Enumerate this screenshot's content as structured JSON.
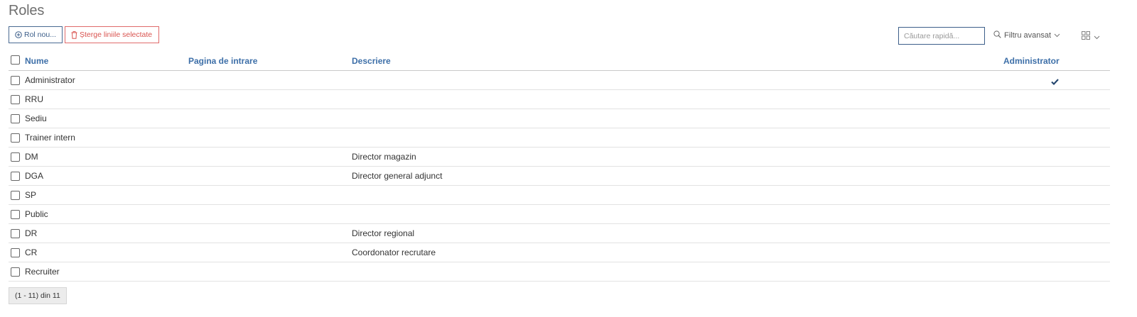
{
  "page": {
    "title": "Roles"
  },
  "toolbar": {
    "new_label": "Rol nou...",
    "delete_label": "Șterge liniile selectate",
    "search_placeholder": "Căutare rapidă...",
    "advanced_filter_label": "Filtru avansat"
  },
  "table": {
    "columns": {
      "name": "Nume",
      "entry_page": "Pagina de intrare",
      "description": "Descriere",
      "administrator": "Administrator"
    },
    "rows": [
      {
        "name": "Administrator",
        "entry_page": "",
        "description": "",
        "administrator": true
      },
      {
        "name": "RRU",
        "entry_page": "",
        "description": "",
        "administrator": false
      },
      {
        "name": "Sediu",
        "entry_page": "",
        "description": "",
        "administrator": false
      },
      {
        "name": "Trainer intern",
        "entry_page": "",
        "description": "",
        "administrator": false
      },
      {
        "name": "DM",
        "entry_page": "",
        "description": "Director magazin",
        "administrator": false
      },
      {
        "name": "DGA",
        "entry_page": "",
        "description": "Director general adjunct",
        "administrator": false
      },
      {
        "name": "SP",
        "entry_page": "",
        "description": "",
        "administrator": false
      },
      {
        "name": "Public",
        "entry_page": "",
        "description": "",
        "administrator": false
      },
      {
        "name": "DR",
        "entry_page": "",
        "description": "Director regional",
        "administrator": false
      },
      {
        "name": "CR",
        "entry_page": "",
        "description": "Coordonator recrutare",
        "administrator": false
      },
      {
        "name": "Recruiter",
        "entry_page": "",
        "description": "",
        "administrator": false
      }
    ]
  },
  "pager": {
    "text": "(1 - 11) din 11"
  },
  "icons": {
    "new": "plus-circle-icon",
    "delete": "trash-icon",
    "search": "search-icon",
    "chevron": "chevron-down-icon",
    "grid": "grid-view-icon",
    "check": "checkmark-icon"
  },
  "colors": {
    "accent": "#3d6fa8",
    "danger": "#d9534f",
    "title": "#6f6f6f",
    "check": "#24466e"
  }
}
